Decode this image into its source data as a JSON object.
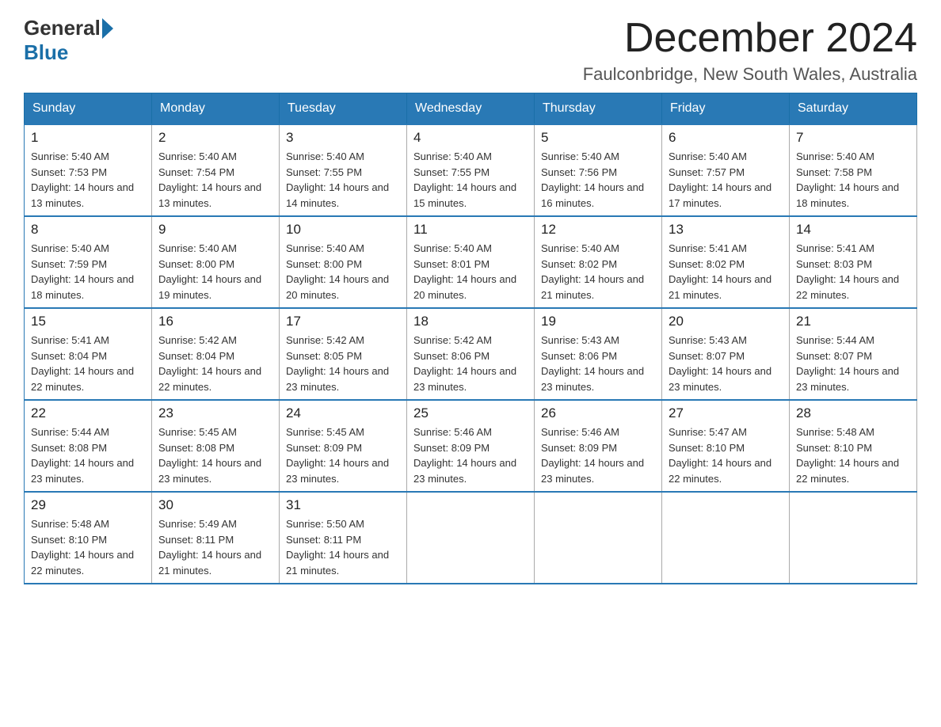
{
  "header": {
    "logo_general": "General",
    "logo_blue": "Blue",
    "month_title": "December 2024",
    "location": "Faulconbridge, New South Wales, Australia"
  },
  "days_of_week": [
    "Sunday",
    "Monday",
    "Tuesday",
    "Wednesday",
    "Thursday",
    "Friday",
    "Saturday"
  ],
  "weeks": [
    [
      {
        "day": "1",
        "sunrise": "5:40 AM",
        "sunset": "7:53 PM",
        "daylight": "14 hours and 13 minutes."
      },
      {
        "day": "2",
        "sunrise": "5:40 AM",
        "sunset": "7:54 PM",
        "daylight": "14 hours and 13 minutes."
      },
      {
        "day": "3",
        "sunrise": "5:40 AM",
        "sunset": "7:55 PM",
        "daylight": "14 hours and 14 minutes."
      },
      {
        "day": "4",
        "sunrise": "5:40 AM",
        "sunset": "7:55 PM",
        "daylight": "14 hours and 15 minutes."
      },
      {
        "day": "5",
        "sunrise": "5:40 AM",
        "sunset": "7:56 PM",
        "daylight": "14 hours and 16 minutes."
      },
      {
        "day": "6",
        "sunrise": "5:40 AM",
        "sunset": "7:57 PM",
        "daylight": "14 hours and 17 minutes."
      },
      {
        "day": "7",
        "sunrise": "5:40 AM",
        "sunset": "7:58 PM",
        "daylight": "14 hours and 18 minutes."
      }
    ],
    [
      {
        "day": "8",
        "sunrise": "5:40 AM",
        "sunset": "7:59 PM",
        "daylight": "14 hours and 18 minutes."
      },
      {
        "day": "9",
        "sunrise": "5:40 AM",
        "sunset": "8:00 PM",
        "daylight": "14 hours and 19 minutes."
      },
      {
        "day": "10",
        "sunrise": "5:40 AM",
        "sunset": "8:00 PM",
        "daylight": "14 hours and 20 minutes."
      },
      {
        "day": "11",
        "sunrise": "5:40 AM",
        "sunset": "8:01 PM",
        "daylight": "14 hours and 20 minutes."
      },
      {
        "day": "12",
        "sunrise": "5:40 AM",
        "sunset": "8:02 PM",
        "daylight": "14 hours and 21 minutes."
      },
      {
        "day": "13",
        "sunrise": "5:41 AM",
        "sunset": "8:02 PM",
        "daylight": "14 hours and 21 minutes."
      },
      {
        "day": "14",
        "sunrise": "5:41 AM",
        "sunset": "8:03 PM",
        "daylight": "14 hours and 22 minutes."
      }
    ],
    [
      {
        "day": "15",
        "sunrise": "5:41 AM",
        "sunset": "8:04 PM",
        "daylight": "14 hours and 22 minutes."
      },
      {
        "day": "16",
        "sunrise": "5:42 AM",
        "sunset": "8:04 PM",
        "daylight": "14 hours and 22 minutes."
      },
      {
        "day": "17",
        "sunrise": "5:42 AM",
        "sunset": "8:05 PM",
        "daylight": "14 hours and 23 minutes."
      },
      {
        "day": "18",
        "sunrise": "5:42 AM",
        "sunset": "8:06 PM",
        "daylight": "14 hours and 23 minutes."
      },
      {
        "day": "19",
        "sunrise": "5:43 AM",
        "sunset": "8:06 PM",
        "daylight": "14 hours and 23 minutes."
      },
      {
        "day": "20",
        "sunrise": "5:43 AM",
        "sunset": "8:07 PM",
        "daylight": "14 hours and 23 minutes."
      },
      {
        "day": "21",
        "sunrise": "5:44 AM",
        "sunset": "8:07 PM",
        "daylight": "14 hours and 23 minutes."
      }
    ],
    [
      {
        "day": "22",
        "sunrise": "5:44 AM",
        "sunset": "8:08 PM",
        "daylight": "14 hours and 23 minutes."
      },
      {
        "day": "23",
        "sunrise": "5:45 AM",
        "sunset": "8:08 PM",
        "daylight": "14 hours and 23 minutes."
      },
      {
        "day": "24",
        "sunrise": "5:45 AM",
        "sunset": "8:09 PM",
        "daylight": "14 hours and 23 minutes."
      },
      {
        "day": "25",
        "sunrise": "5:46 AM",
        "sunset": "8:09 PM",
        "daylight": "14 hours and 23 minutes."
      },
      {
        "day": "26",
        "sunrise": "5:46 AM",
        "sunset": "8:09 PM",
        "daylight": "14 hours and 23 minutes."
      },
      {
        "day": "27",
        "sunrise": "5:47 AM",
        "sunset": "8:10 PM",
        "daylight": "14 hours and 22 minutes."
      },
      {
        "day": "28",
        "sunrise": "5:48 AM",
        "sunset": "8:10 PM",
        "daylight": "14 hours and 22 minutes."
      }
    ],
    [
      {
        "day": "29",
        "sunrise": "5:48 AM",
        "sunset": "8:10 PM",
        "daylight": "14 hours and 22 minutes."
      },
      {
        "day": "30",
        "sunrise": "5:49 AM",
        "sunset": "8:11 PM",
        "daylight": "14 hours and 21 minutes."
      },
      {
        "day": "31",
        "sunrise": "5:50 AM",
        "sunset": "8:11 PM",
        "daylight": "14 hours and 21 minutes."
      },
      null,
      null,
      null,
      null
    ]
  ]
}
